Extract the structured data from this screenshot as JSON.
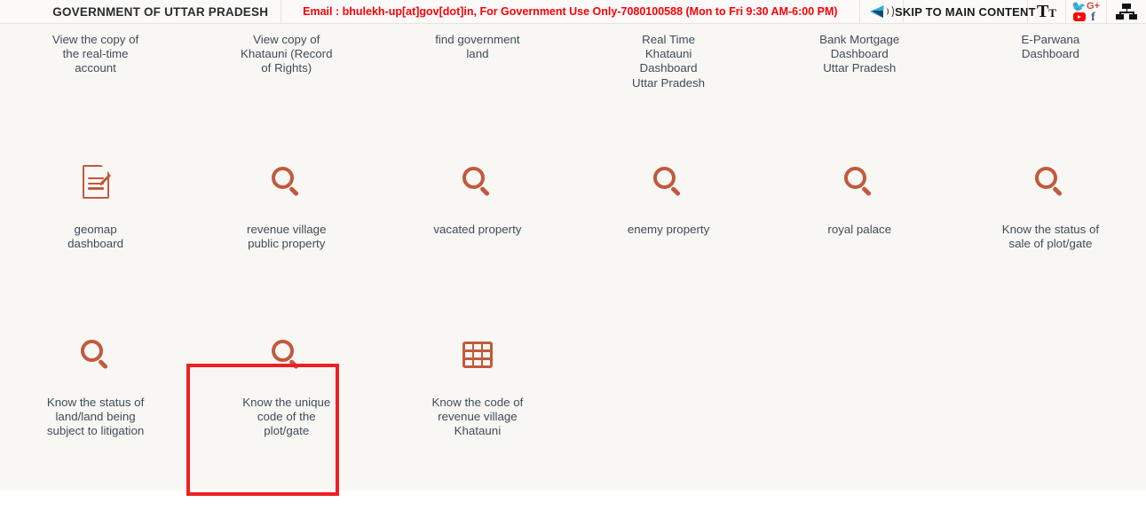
{
  "header": {
    "government_title": "GOVERNMENT OF UTTAR PRADESH",
    "email_notice": "Email : bhulekh-up[at]gov[dot]in, For Government Use Only-7080100588 (Mon to Fri 9:30 AM-6:00 PM)",
    "skip_link": "SKIP TO MAIN CONTENT",
    "icons": {
      "audio": "speaker-audio-icon",
      "text_size": "text-size-icon",
      "text_size_big": "T",
      "text_size_small": "T",
      "social": [
        "twitter-icon",
        "google-plus-icon",
        "youtube-icon",
        "facebook-icon"
      ],
      "google_plus_label": "G+",
      "facebook_label": "f",
      "sitemap": "sitemap-icon"
    },
    "colors": {
      "email_red": "#fb0007",
      "bar_background": "#fbfaf8",
      "divider": "#e6e4df"
    }
  },
  "content": {
    "background": "#f8f7f3",
    "icon_color": "#c2593d",
    "label_color": "#3f4c5a",
    "highlight_color": "#ed2024",
    "row1": [
      {
        "label": "View the copy of\nthe real-time\naccount"
      },
      {
        "label": "View copy of\nKhatauni (Record\nof Rights)"
      },
      {
        "label": "find government\nland"
      },
      {
        "label": "Real Time\nKhatauni\nDashboard\nUttar Pradesh"
      },
      {
        "label": "Bank Mortgage\nDashboard\nUttar Pradesh"
      },
      {
        "label": "E-Parwana\nDashboard"
      }
    ],
    "row2": [
      {
        "icon": "document-icon",
        "label": "geomap\ndashboard"
      },
      {
        "icon": "search-icon",
        "label": "revenue village\npublic property"
      },
      {
        "icon": "search-icon",
        "label": "vacated property"
      },
      {
        "icon": "search-icon",
        "label": "enemy property"
      },
      {
        "icon": "search-icon",
        "label": "royal palace"
      },
      {
        "icon": "search-icon",
        "label": "Know the status of\nsale of plot/gate"
      }
    ],
    "row3": [
      {
        "icon": "search-icon",
        "label": "Know the status of\nland/land being\nsubject to litigation",
        "highlighted": false
      },
      {
        "icon": "search-icon",
        "label": "Know the unique\ncode of the\nplot/gate",
        "highlighted": true
      },
      {
        "icon": "table-icon",
        "label": "Know the code of\nrevenue village\nKhatauni",
        "highlighted": false
      }
    ]
  }
}
